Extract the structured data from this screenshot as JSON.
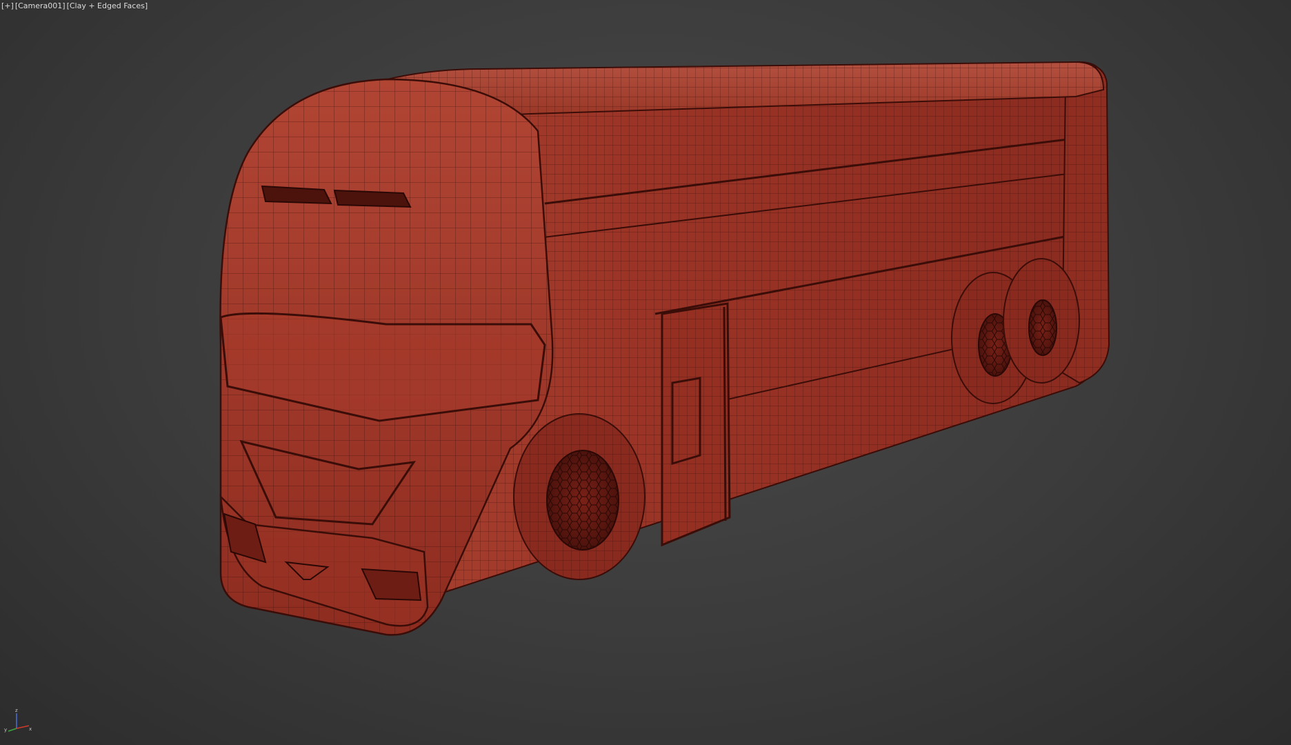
{
  "viewport": {
    "label_menu": "[+]",
    "label_view": "[Camera001]",
    "label_shading": "[Clay + Edged Faces]"
  },
  "axis_gizmo": {
    "x_label": "x",
    "y_label": "y",
    "z_label": "z",
    "x_color": "#d23a2a",
    "y_color": "#3fa53f",
    "z_color": "#4a6fd8"
  },
  "colors": {
    "clay": "#a33a2c",
    "clay_shadow": "#6e1d14",
    "wire": "#3a0d08",
    "background": "#3a3a3a"
  },
  "scene": {
    "object": "bus-model"
  }
}
